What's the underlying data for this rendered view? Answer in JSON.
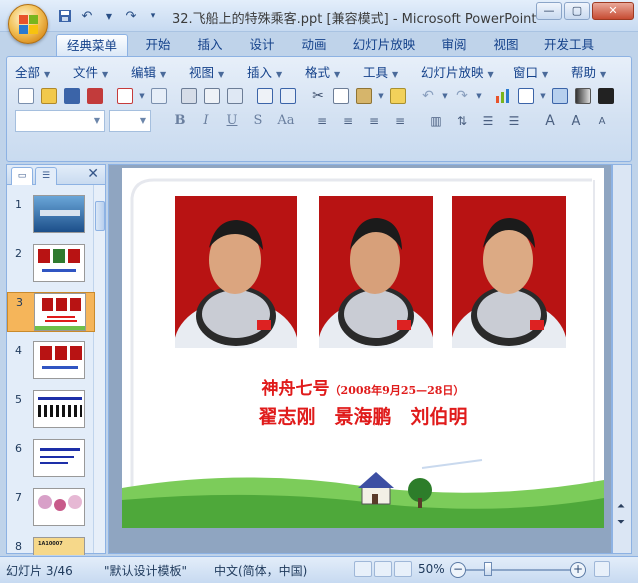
{
  "window": {
    "title": "32.飞船上的特殊乘客.ppt [兼容模式] - Microsoft PowerPoint",
    "controls": {
      "minimize": "—",
      "restore": "▢",
      "close": "✕"
    }
  },
  "quick_access": {
    "save_icon": "save-icon",
    "undo_icon": "undo-icon",
    "redo_icon": "redo-icon",
    "customize_icon": "customize-icon"
  },
  "tabs": [
    "经典菜单",
    "开始",
    "插入",
    "设计",
    "动画",
    "幻灯片放映",
    "审阅",
    "视图",
    "开发工具"
  ],
  "active_tab": "经典菜单",
  "classic_menu": [
    "全部",
    "文件",
    "编辑",
    "视图",
    "插入",
    "格式",
    "工具",
    "幻灯片放映",
    "窗口",
    "帮助"
  ],
  "format_buttons": [
    "B",
    "I",
    "U",
    "S",
    "Aa"
  ],
  "left_panel": {
    "tab_icons": [
      "slides-tab-icon",
      "outline-tab-icon"
    ],
    "close": "✕",
    "thumbnails": [
      {
        "num": "1"
      },
      {
        "num": "2"
      },
      {
        "num": "3",
        "selected": true
      },
      {
        "num": "4"
      },
      {
        "num": "5"
      },
      {
        "num": "6"
      },
      {
        "num": "7"
      },
      {
        "num": "8",
        "thumb_text": "1A10007"
      }
    ]
  },
  "slide": {
    "line1_main": "神舟七号",
    "line1_date": "（2008年9月25—28日）",
    "line2": "翟志刚　景海鹏　刘伯明"
  },
  "status_bar": {
    "slide_counter": "幻灯片 3/46",
    "theme": "\"默认设计模板\"",
    "language": "中文(简体，中国)",
    "zoom": "50%",
    "zoom_level_fraction": 0.5
  },
  "colors": {
    "accent": "#e01b1b",
    "ribbon": "#d3e1f2",
    "photo_bg": "#b81313",
    "selected_thumb": "#f5b55a"
  }
}
